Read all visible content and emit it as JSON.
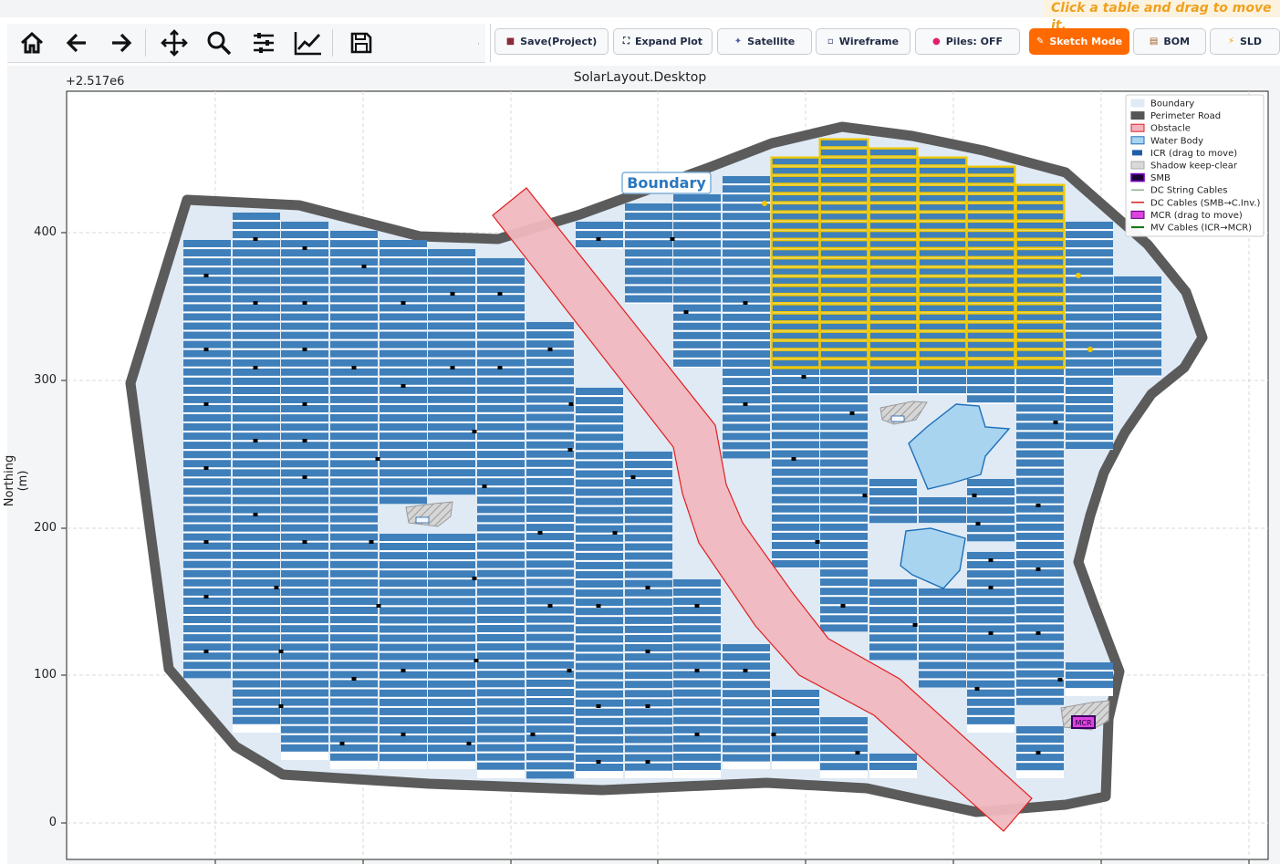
{
  "hint": "Click a table and drag to move it.",
  "toolbar": {
    "nav_icons": [
      "home-icon",
      "back-arrow-icon",
      "forward-arrow-icon",
      "pan-icon",
      "zoom-icon",
      "configure-subplots-icon",
      "edit-axis-icon",
      "save-figure-icon"
    ],
    "buttons": [
      {
        "label": "Save(Project)",
        "icon": "floppy-icon"
      },
      {
        "label": "Expand Plot",
        "icon": "expand-icon"
      },
      {
        "label": "Satellite",
        "icon": "satellite-icon"
      },
      {
        "label": "Wireframe",
        "icon": "wireframe-icon"
      },
      {
        "label": "Piles: OFF",
        "icon": "pin-icon"
      },
      {
        "label": "Sketch Mode",
        "icon": "pencil-icon",
        "active": true
      },
      {
        "label": "BOM",
        "icon": "clipboard-icon"
      },
      {
        "label": "SLD",
        "icon": "bolt-icon"
      }
    ],
    "active_color": "#ff6a00"
  },
  "plot": {
    "title": "SolarLayout.Desktop",
    "offset_text": "+2.517e6",
    "ylabel": "Northing (m)",
    "yticks": [
      "400",
      "300",
      "200",
      "100",
      "0"
    ],
    "boundary_label": "Boundary",
    "mcr_label": "MCR",
    "icr_label": "ICR",
    "legend": [
      {
        "label": "Boundary",
        "kind": "fill",
        "fill": "#dfeaf5",
        "stroke": "#dfeaf5"
      },
      {
        "label": "Perimeter Road",
        "kind": "fill",
        "fill": "#555555",
        "stroke": "#555555"
      },
      {
        "label": "Obstacle",
        "kind": "fill",
        "fill": "#f4b4bb",
        "stroke": "#e02020"
      },
      {
        "label": "Water Body",
        "kind": "fill",
        "fill": "#a8d4f0",
        "stroke": "#1e6fb8"
      },
      {
        "label": "ICR (drag to move)",
        "kind": "small",
        "fill": "#1f5fa8",
        "stroke": "#1f5fa8"
      },
      {
        "label": "Shadow keep-clear",
        "kind": "fill",
        "fill": "#d9d9d9",
        "stroke": "#aaaaaa"
      },
      {
        "label": "SMB",
        "kind": "fill",
        "fill": "#1a0033",
        "stroke": "#7a00cc"
      },
      {
        "label": "DC String Cables",
        "kind": "line",
        "fill": "#88aa88",
        "stroke": "#88aa88"
      },
      {
        "label": "DC Cables (SMB→C.Inv.)",
        "kind": "line",
        "fill": "#d01010",
        "stroke": "#d01010"
      },
      {
        "label": "MCR (drag to move)",
        "kind": "fill",
        "fill": "#dd44dd",
        "stroke": "#5a0080"
      },
      {
        "label": "MV Cables (ICR→MCR)",
        "kind": "line",
        "fill": "#1a7a1a",
        "stroke": "#1a7a1a"
      }
    ],
    "colors": {
      "panel": "#3f7fba",
      "highlight": "#f0c800",
      "boundary_fill": "#dfeaf5",
      "road": "#555555"
    }
  }
}
